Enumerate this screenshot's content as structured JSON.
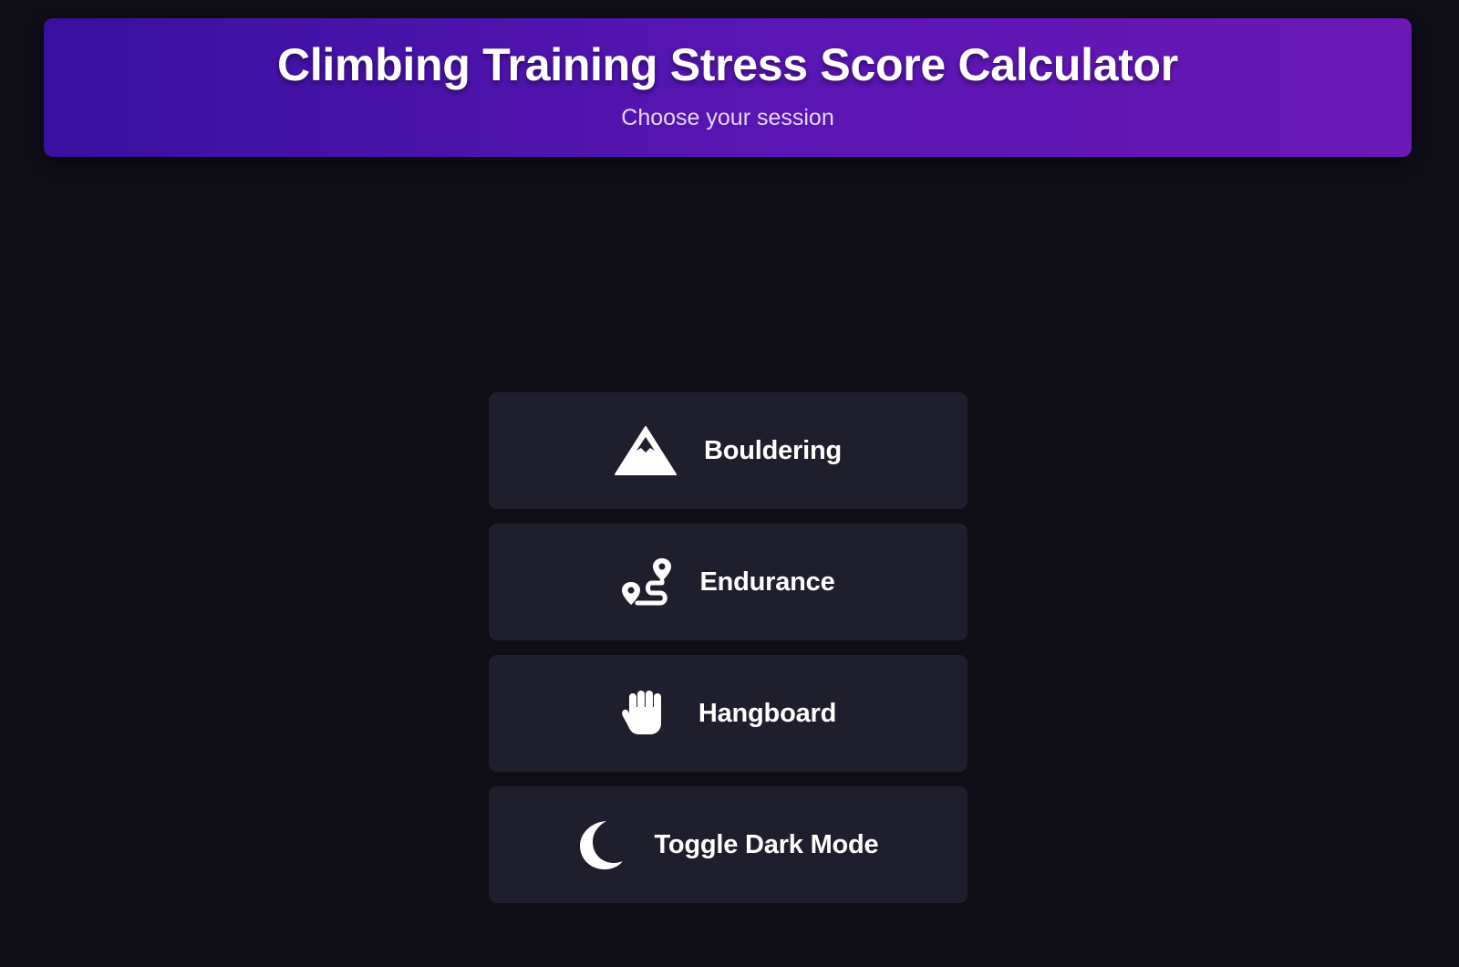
{
  "header": {
    "title": "Climbing Training Stress Score Calculator",
    "subtitle": "Choose your session"
  },
  "menu": {
    "items": [
      {
        "label": "Bouldering",
        "icon": "mountain-icon"
      },
      {
        "label": "Endurance",
        "icon": "route-icon"
      },
      {
        "label": "Hangboard",
        "icon": "hand-icon"
      },
      {
        "label": "Toggle Dark Mode",
        "icon": "moon-icon"
      }
    ]
  },
  "colors": {
    "background": "#0f0e17",
    "header_gradient_start": "#3910a0",
    "header_gradient_end": "#6a18b6",
    "button_background": "#1f1e2d",
    "text": "#ffffff"
  }
}
